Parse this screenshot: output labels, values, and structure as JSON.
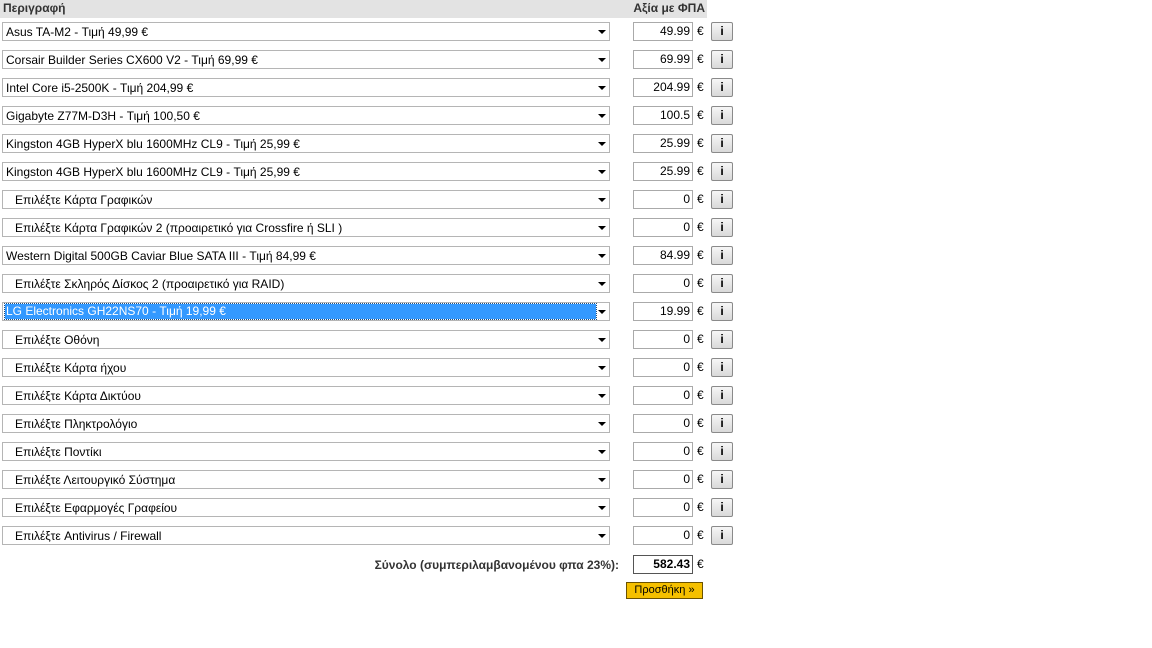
{
  "header": {
    "description": "Περιγραφή",
    "price": "Αξία με ΦΠΑ"
  },
  "currency": "€",
  "info_label": "i",
  "rows": [
    {
      "text": "Asus TA-M2 - Τιμή 49,99 €",
      "price": "49.99",
      "placeholder": false
    },
    {
      "text": "Corsair Builder Series CX600 V2 - Τιμή 69,99 €",
      "price": "69.99",
      "placeholder": false
    },
    {
      "text": "Intel Core i5-2500K - Τιμή 204,99 €",
      "price": "204.99",
      "placeholder": false
    },
    {
      "text": "Gigabyte Z77M-D3H - Τιμή 100,50 €",
      "price": "100.5",
      "placeholder": false
    },
    {
      "text": "Kingston 4GB HyperX blu 1600MHz CL9 - Τιμή 25,99 €",
      "price": "25.99",
      "placeholder": false
    },
    {
      "text": "Kingston 4GB HyperX blu 1600MHz CL9 - Τιμή 25,99 €",
      "price": "25.99",
      "placeholder": false
    },
    {
      "text": "Επιλέξτε Κάρτα Γραφικών",
      "price": "0",
      "placeholder": true
    },
    {
      "text": "Επιλέξτε Κάρτα Γραφικών 2 (προαιρετικό για Crossfire ή SLI )",
      "price": "0",
      "placeholder": true
    },
    {
      "text": "Western Digital 500GB Caviar Blue SATA III - Τιμή 84,99 €",
      "price": "84.99",
      "placeholder": false
    },
    {
      "text": "Επιλέξτε Σκληρός Δίσκος 2 (προαιρετικό για RAID)",
      "price": "0",
      "placeholder": true
    },
    {
      "text": "LG Electronics GH22NS70 - Τιμή 19,99 €",
      "price": "19.99",
      "placeholder": false,
      "selected": true
    },
    {
      "text": "Επιλέξτε Οθόνη",
      "price": "0",
      "placeholder": true
    },
    {
      "text": "Επιλέξτε Κάρτα ήχου",
      "price": "0",
      "placeholder": true
    },
    {
      "text": "Επιλέξτε Κάρτα Δικτύου",
      "price": "0",
      "placeholder": true
    },
    {
      "text": "Επιλέξτε Πληκτρολόγιο",
      "price": "0",
      "placeholder": true
    },
    {
      "text": "Επιλέξτε Ποντίκι",
      "price": "0",
      "placeholder": true
    },
    {
      "text": "Επιλέξτε Λειτουργικό Σύστημα",
      "price": "0",
      "placeholder": true
    },
    {
      "text": "Επιλέξτε Εφαρμογές Γραφείου",
      "price": "0",
      "placeholder": true
    },
    {
      "text": "Επιλέξτε Antivirus / Firewall",
      "price": "0",
      "placeholder": true
    }
  ],
  "total": {
    "label": "Σύνολο (συμπεριλαμβανομένου φπα 23%):",
    "value": "582.43"
  },
  "add_button": "Προσθήκη »",
  "colors": {
    "selected_highlight": "#3399ff",
    "add_button": "#f5c000",
    "header_bg": "#e3e3e3"
  }
}
